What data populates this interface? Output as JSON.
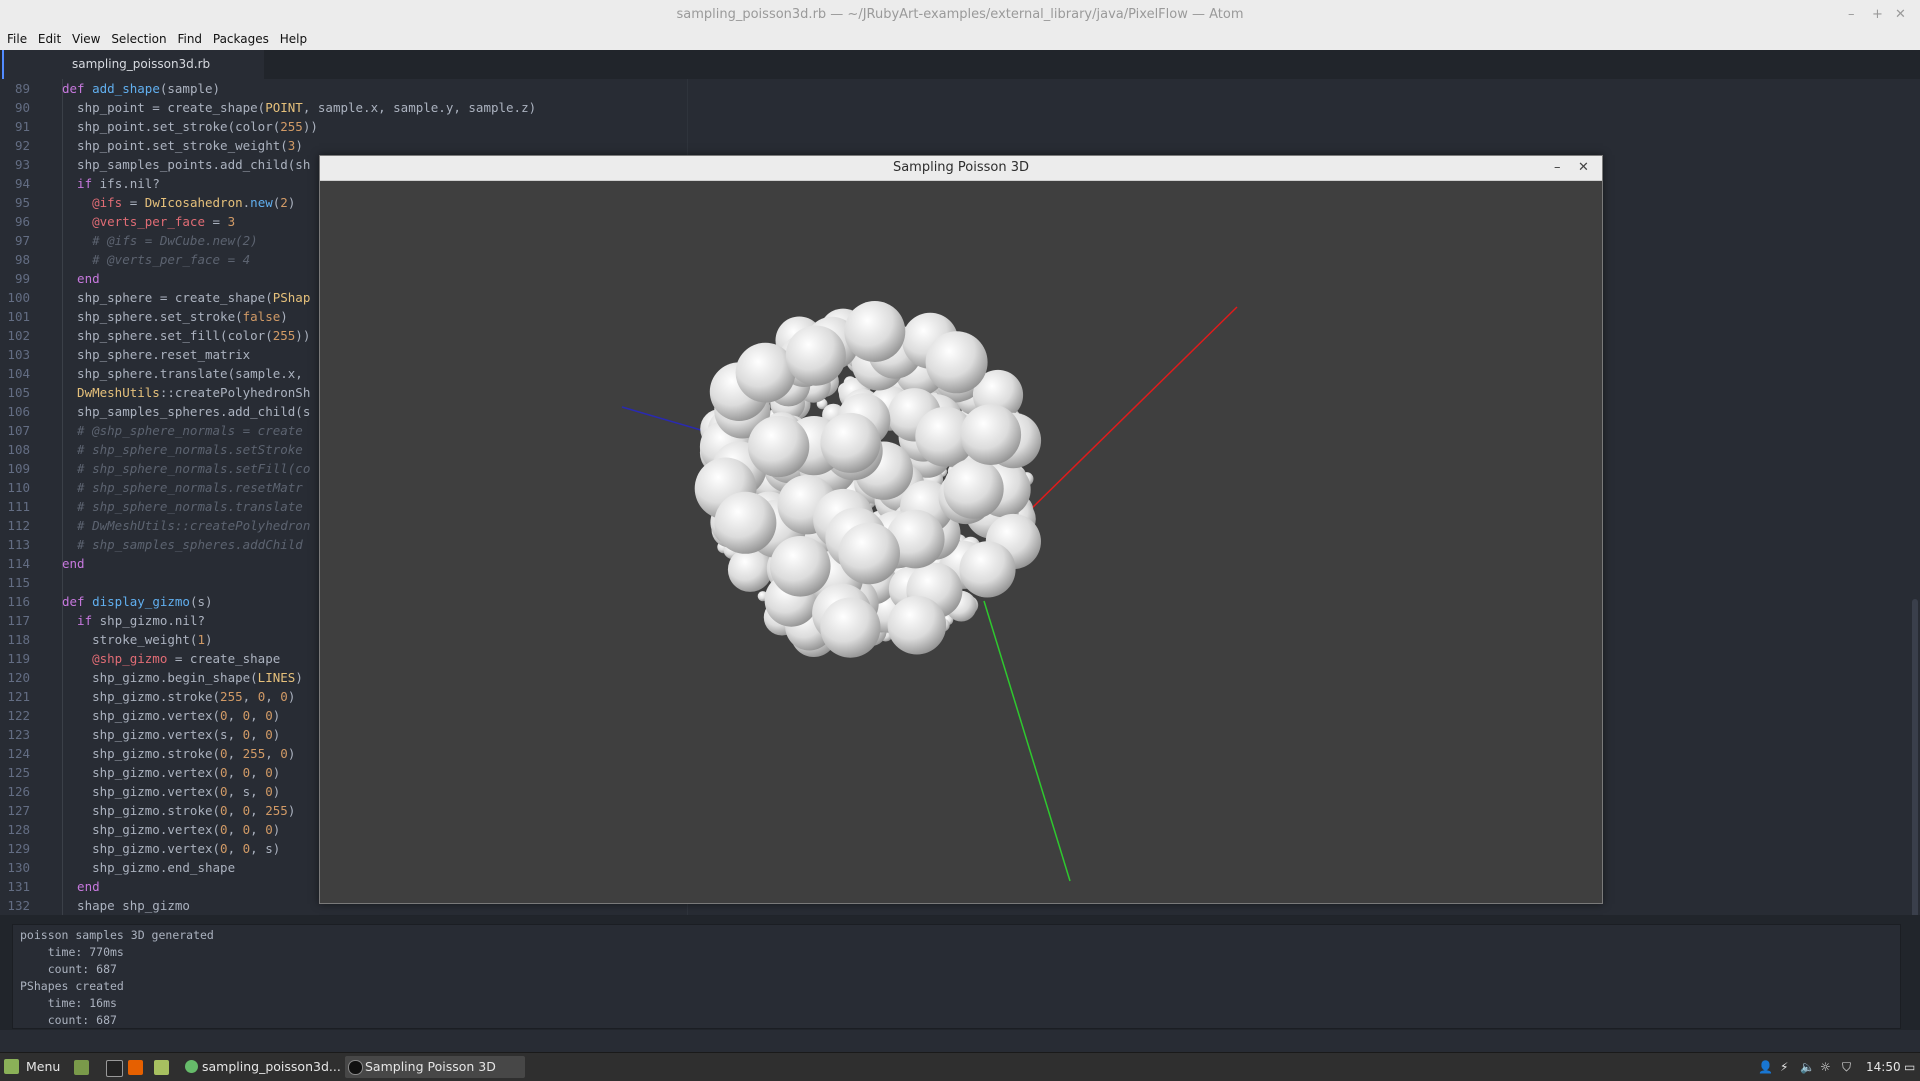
{
  "window": {
    "title": "sampling_poisson3d.rb — ~/JRubyArt-examples/external_library/java/PixelFlow — Atom",
    "controls": [
      "–",
      "+",
      "✕"
    ]
  },
  "menu": [
    "File",
    "Edit",
    "View",
    "Selection",
    "Find",
    "Packages",
    "Help"
  ],
  "tab": {
    "label": "sampling_poisson3d.rb"
  },
  "editor": {
    "first_line": 89,
    "lines": [
      [
        [
          "kw",
          "def "
        ],
        [
          "fn",
          "add_shape"
        ],
        [
          "nm",
          "(sample)"
        ]
      ],
      [
        [
          "nm",
          "  shp_point = create_shape("
        ],
        [
          "cn",
          "POINT"
        ],
        [
          "nm",
          ", sample.x, sample.y, sample.z)"
        ]
      ],
      [
        [
          "nm",
          "  shp_point.set_stroke(color("
        ],
        [
          "nu",
          "255"
        ],
        [
          "nm",
          "))"
        ]
      ],
      [
        [
          "nm",
          "  shp_point.set_stroke_weight("
        ],
        [
          "nu",
          "3"
        ],
        [
          "nm",
          ")"
        ]
      ],
      [
        [
          "nm",
          "  shp_samples_points.add_child(sh"
        ]
      ],
      [
        [
          "kw",
          "  if "
        ],
        [
          "nm",
          "ifs.nil?"
        ]
      ],
      [
        [
          "iv",
          "    @ifs"
        ],
        [
          "nm",
          " = "
        ],
        [
          "cn",
          "DwIcosahedron"
        ],
        [
          "nm",
          "."
        ],
        [
          "fn",
          "new"
        ],
        [
          "nm",
          "("
        ],
        [
          "nu",
          "2"
        ],
        [
          "nm",
          ")"
        ]
      ],
      [
        [
          "iv",
          "    @verts_per_face"
        ],
        [
          "nm",
          " = "
        ],
        [
          "nu",
          "3"
        ]
      ],
      [
        [
          "cm",
          "    # @ifs = DwCube.new(2)"
        ]
      ],
      [
        [
          "cm",
          "    # @verts_per_face = 4"
        ]
      ],
      [
        [
          "kw",
          "  end"
        ]
      ],
      [
        [
          "nm",
          "  shp_sphere = create_shape("
        ],
        [
          "cn",
          "PShap"
        ]
      ],
      [
        [
          "nm",
          "  shp_sphere.set_stroke("
        ],
        [
          "nu",
          "false"
        ],
        [
          "nm",
          ")"
        ]
      ],
      [
        [
          "nm",
          "  shp_sphere.set_fill(color("
        ],
        [
          "nu",
          "255"
        ],
        [
          "nm",
          "))"
        ]
      ],
      [
        [
          "nm",
          "  shp_sphere.reset_matrix"
        ]
      ],
      [
        [
          "nm",
          "  shp_sphere.translate(sample.x,"
        ]
      ],
      [
        [
          "cn",
          "  DwMeshUtils"
        ],
        [
          "nm",
          "::createPolyhedronSh"
        ]
      ],
      [
        [
          "nm",
          "  shp_samples_spheres.add_child(s"
        ]
      ],
      [
        [
          "cm",
          "  # @shp_sphere_normals = create"
        ]
      ],
      [
        [
          "cm",
          "  # shp_sphere_normals.setStroke"
        ]
      ],
      [
        [
          "cm",
          "  # shp_sphere_normals.setFill(co"
        ]
      ],
      [
        [
          "cm",
          "  # shp_sphere_normals.resetMatr"
        ]
      ],
      [
        [
          "cm",
          "  # shp_sphere_normals.translate"
        ]
      ],
      [
        [
          "cm",
          "  # DwMeshUtils::createPolyhedron"
        ]
      ],
      [
        [
          "cm",
          "  # shp_samples_spheres.addChild"
        ]
      ],
      [
        [
          "kw",
          "end"
        ]
      ],
      [
        [
          "nm",
          ""
        ]
      ],
      [
        [
          "kw",
          "def "
        ],
        [
          "fn",
          "display_gizmo"
        ],
        [
          "nm",
          "(s)"
        ]
      ],
      [
        [
          "kw",
          "  if "
        ],
        [
          "nm",
          "shp_gizmo.nil?"
        ]
      ],
      [
        [
          "nm",
          "    stroke_weight("
        ],
        [
          "nu",
          "1"
        ],
        [
          "nm",
          ")"
        ]
      ],
      [
        [
          "iv",
          "    @shp_gizmo"
        ],
        [
          "nm",
          " = create_shape"
        ]
      ],
      [
        [
          "nm",
          "    shp_gizmo.begin_shape("
        ],
        [
          "cn",
          "LINES"
        ],
        [
          "nm",
          ")"
        ]
      ],
      [
        [
          "nm",
          "    shp_gizmo.stroke("
        ],
        [
          "nu",
          "255"
        ],
        [
          "nm",
          ", "
        ],
        [
          "nu",
          "0"
        ],
        [
          "nm",
          ", "
        ],
        [
          "nu",
          "0"
        ],
        [
          "nm",
          ")"
        ]
      ],
      [
        [
          "nm",
          "    shp_gizmo.vertex("
        ],
        [
          "nu",
          "0"
        ],
        [
          "nm",
          ", "
        ],
        [
          "nu",
          "0"
        ],
        [
          "nm",
          ", "
        ],
        [
          "nu",
          "0"
        ],
        [
          "nm",
          ")"
        ]
      ],
      [
        [
          "nm",
          "    shp_gizmo.vertex(s, "
        ],
        [
          "nu",
          "0"
        ],
        [
          "nm",
          ", "
        ],
        [
          "nu",
          "0"
        ],
        [
          "nm",
          ")"
        ]
      ],
      [
        [
          "nm",
          "    shp_gizmo.stroke("
        ],
        [
          "nu",
          "0"
        ],
        [
          "nm",
          ", "
        ],
        [
          "nu",
          "255"
        ],
        [
          "nm",
          ", "
        ],
        [
          "nu",
          "0"
        ],
        [
          "nm",
          ")"
        ]
      ],
      [
        [
          "nm",
          "    shp_gizmo.vertex("
        ],
        [
          "nu",
          "0"
        ],
        [
          "nm",
          ", "
        ],
        [
          "nu",
          "0"
        ],
        [
          "nm",
          ", "
        ],
        [
          "nu",
          "0"
        ],
        [
          "nm",
          ")"
        ]
      ],
      [
        [
          "nm",
          "    shp_gizmo.vertex("
        ],
        [
          "nu",
          "0"
        ],
        [
          "nm",
          ", s, "
        ],
        [
          "nu",
          "0"
        ],
        [
          "nm",
          ")"
        ]
      ],
      [
        [
          "nm",
          "    shp_gizmo.stroke("
        ],
        [
          "nu",
          "0"
        ],
        [
          "nm",
          ", "
        ],
        [
          "nu",
          "0"
        ],
        [
          "nm",
          ", "
        ],
        [
          "nu",
          "255"
        ],
        [
          "nm",
          ")"
        ]
      ],
      [
        [
          "nm",
          "    shp_gizmo.vertex("
        ],
        [
          "nu",
          "0"
        ],
        [
          "nm",
          ", "
        ],
        [
          "nu",
          "0"
        ],
        [
          "nm",
          ", "
        ],
        [
          "nu",
          "0"
        ],
        [
          "nm",
          ")"
        ]
      ],
      [
        [
          "nm",
          "    shp_gizmo.vertex("
        ],
        [
          "nu",
          "0"
        ],
        [
          "nm",
          ", "
        ],
        [
          "nu",
          "0"
        ],
        [
          "nm",
          ", s)"
        ]
      ],
      [
        [
          "nm",
          "    shp_gizmo.end_shape"
        ]
      ],
      [
        [
          "kw",
          "  end"
        ]
      ],
      [
        [
          "nm",
          "  shape shp_gizmo"
        ]
      ]
    ]
  },
  "console": {
    "lines": [
      "poisson samples 3D generated",
      "    time: 770ms",
      "    count: 687",
      "PShapes created",
      "    time: 16ms",
      "    count: 687"
    ]
  },
  "app_window": {
    "title": "Sampling Poisson 3D",
    "controls": [
      "–",
      "✕"
    ],
    "axes": [
      {
        "color": "#e01b1b"
      },
      {
        "color": "#2ec82e"
      },
      {
        "color": "#2a2ab0"
      }
    ]
  },
  "taskbar": {
    "menu_label": "Menu",
    "items": [
      "sampling_poisson3d...",
      "Sampling Poisson 3D"
    ],
    "clock": "14:50",
    "tray_icons": [
      "user-icon",
      "network-icon",
      "volume-icon",
      "brightness-icon",
      "shield-icon",
      "desktop-icon"
    ]
  }
}
